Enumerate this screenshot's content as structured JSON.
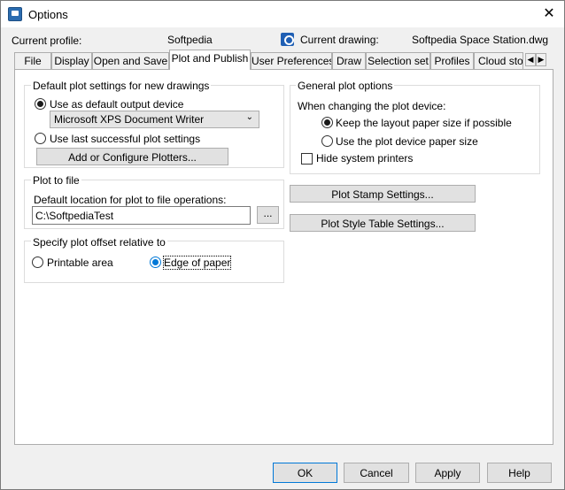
{
  "window": {
    "title": "Options",
    "close_glyph": "✕"
  },
  "header": {
    "profile_label": "Current profile:",
    "profile_value": "Softpedia",
    "drawing_label": "Current drawing:",
    "drawing_value": "Softpedia Space Station.dwg"
  },
  "tabs": [
    {
      "label": "File"
    },
    {
      "label": "Display"
    },
    {
      "label": "Open and Save"
    },
    {
      "label": "Plot and Publish"
    },
    {
      "label": "User Preferences"
    },
    {
      "label": "Draw"
    },
    {
      "label": "Selection set"
    },
    {
      "label": "Profiles"
    },
    {
      "label": "Cloud stora"
    }
  ],
  "active_tab": "Plot and Publish",
  "tab_scroll": {
    "left": "◀",
    "right": "▶"
  },
  "default_plot": {
    "title": "Default plot settings for new drawings",
    "use_default_label": "Use as default output device",
    "device_value": "Microsoft XPS Document Writer",
    "use_last_label": "Use last successful plot settings",
    "add_plotters_label": "Add or Configure Plotters..."
  },
  "plot_to_file": {
    "title": "Plot to file",
    "location_label": "Default location for plot to file operations:",
    "location_value": "C:\\SoftpediaTest",
    "browse_label": "..."
  },
  "plot_offset": {
    "title": "Specify plot offset relative to",
    "printable_label": "Printable area",
    "edge_label": "Edge of paper"
  },
  "general": {
    "title": "General plot options",
    "changing_label": "When changing the plot device:",
    "keep_layout_label": "Keep the layout paper size if possible",
    "use_device_label": "Use the plot device paper size",
    "hide_printers_label": "Hide system printers"
  },
  "plot_stamp_label": "Plot Stamp Settings...",
  "plot_style_label": "Plot Style Table Settings...",
  "footer": {
    "ok": "OK",
    "cancel": "Cancel",
    "apply": "Apply",
    "help": "Help"
  },
  "colors": {
    "accent": "#0078d7",
    "panel": "#ffffff",
    "chrome": "#f0f0f0"
  }
}
